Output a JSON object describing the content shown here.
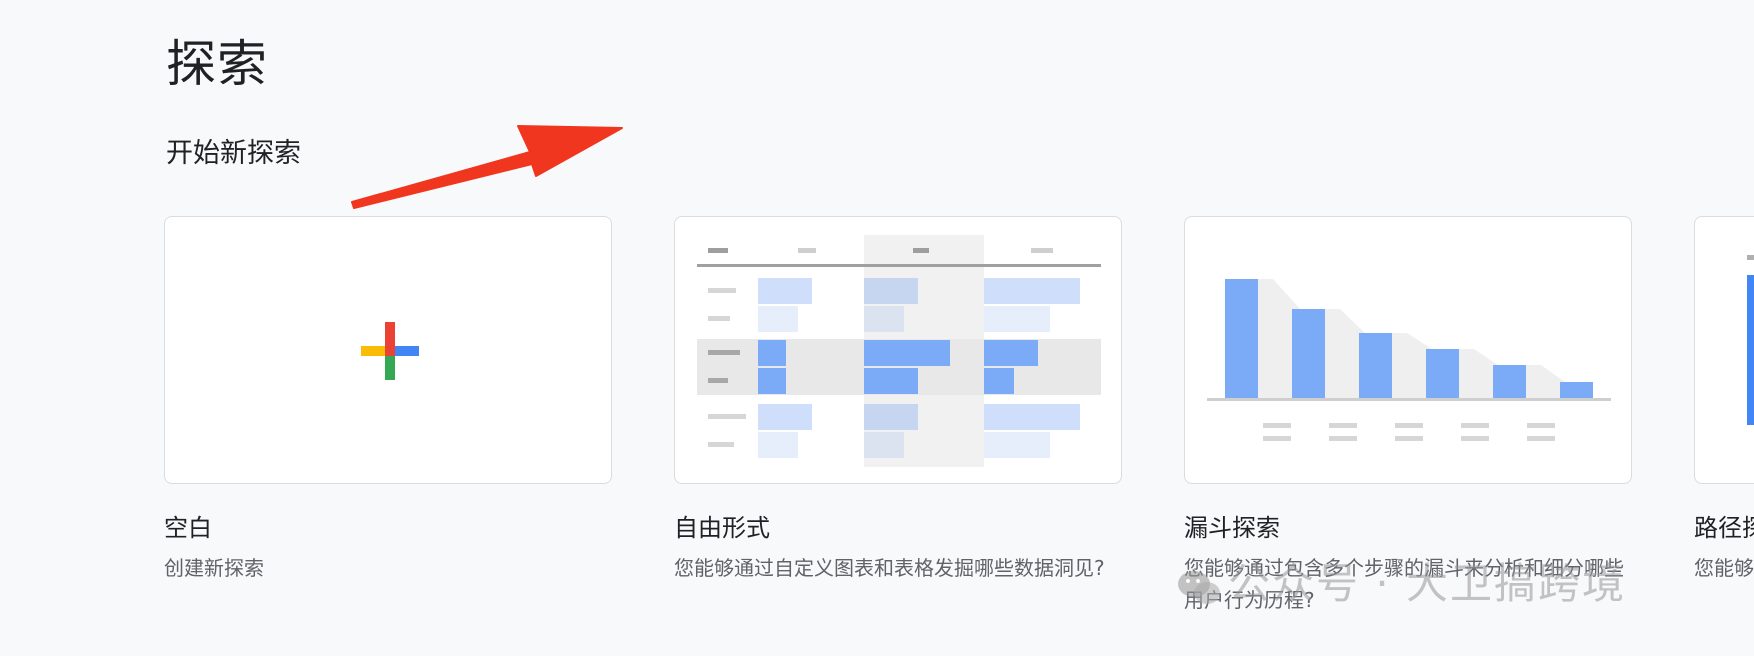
{
  "page": {
    "title": "探索"
  },
  "section": {
    "title": "开始新探索"
  },
  "cards": [
    {
      "title": "空白",
      "description": "创建新探索"
    },
    {
      "title": "自由形式",
      "description": "您能够通过自定义图表和表格发掘哪些数据洞见?"
    },
    {
      "title": "漏斗探索",
      "description": "您能够通过包含多个步骤的漏斗来分析和细分哪些用户行为历程?"
    },
    {
      "title": "路径探索",
      "description": "您能够"
    }
  ],
  "watermark": {
    "text": "公众号 · 大卫搞跨境"
  },
  "colors": {
    "background": "#f8f9fa",
    "card_border": "#dadce0",
    "bar_blue": "#7baaf7",
    "arrow_red": "#f0361f",
    "plus_red": "#ea4335",
    "plus_blue": "#4285f4",
    "plus_green": "#34a853",
    "plus_yellow": "#fbbc05"
  },
  "icons": [
    "plus-icon",
    "freeform-thumbnail",
    "funnel-thumbnail",
    "path-thumbnail",
    "wechat-icon",
    "arrow-annotation"
  ]
}
